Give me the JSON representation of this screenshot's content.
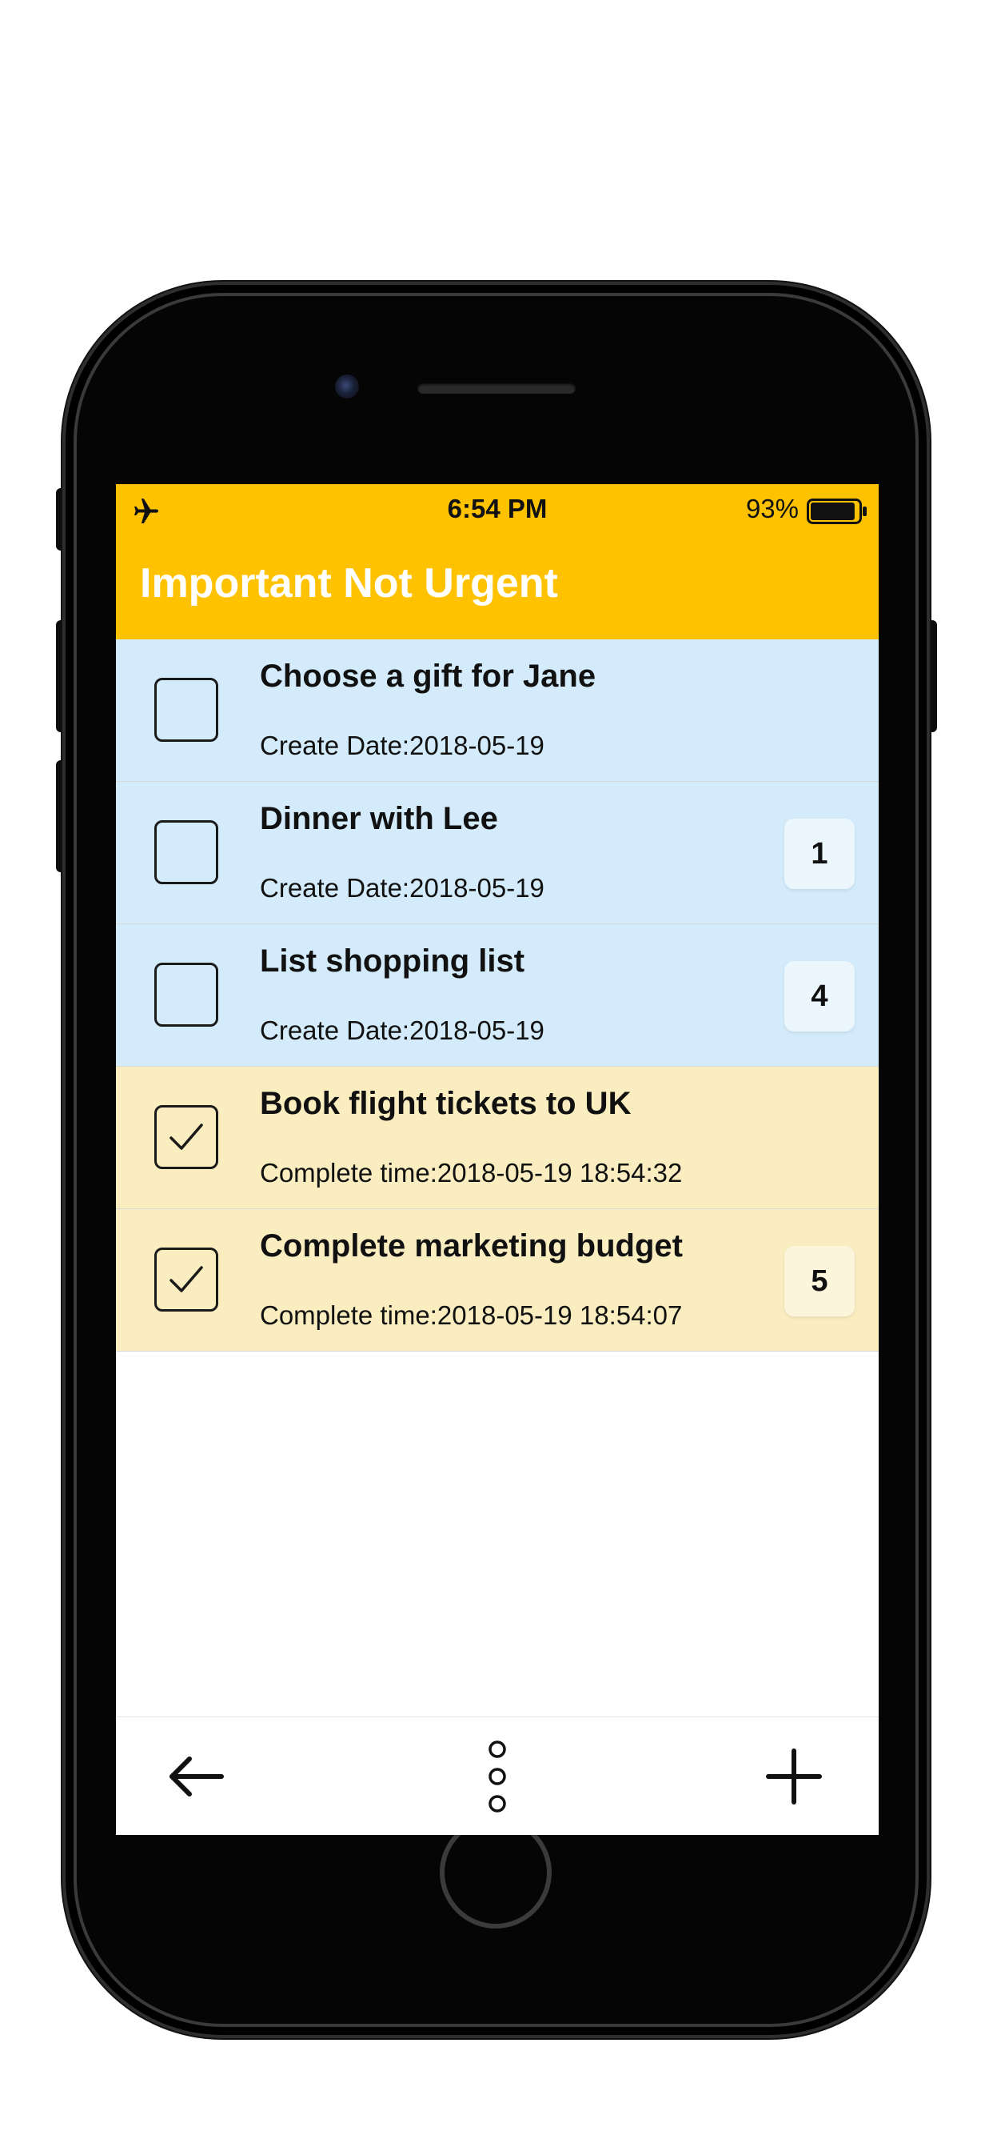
{
  "status_bar": {
    "time": "6:54 PM",
    "battery_percent": "93%",
    "battery_level": 0.93,
    "icons": [
      "airplane-icon",
      "battery-icon"
    ]
  },
  "header": {
    "title": "Important Not Urgent",
    "background_color": "#FFC200"
  },
  "tasks": [
    {
      "title": "Choose a gift for Jane",
      "meta": "Create Date:2018-05-19",
      "checked": false,
      "badge": ""
    },
    {
      "title": "Dinner with Lee",
      "meta": "Create Date:2018-05-19",
      "checked": false,
      "badge": "1"
    },
    {
      "title": "List shopping list",
      "meta": "Create Date:2018-05-19",
      "checked": false,
      "badge": "4"
    },
    {
      "title": "Book flight tickets to UK",
      "meta": "Complete time:2018-05-19 18:54:32",
      "checked": true,
      "badge": ""
    },
    {
      "title": "Complete marketing budget",
      "meta": "Complete time:2018-05-19 18:54:07",
      "checked": true,
      "badge": "5"
    }
  ],
  "colors": {
    "pending_row": "#D3EBFB",
    "done_row": "#FAEDBF",
    "accent": "#FFC200"
  },
  "toolbar": {
    "icons": [
      "arrow-left-icon",
      "more-vertical-icon",
      "plus-icon"
    ]
  }
}
